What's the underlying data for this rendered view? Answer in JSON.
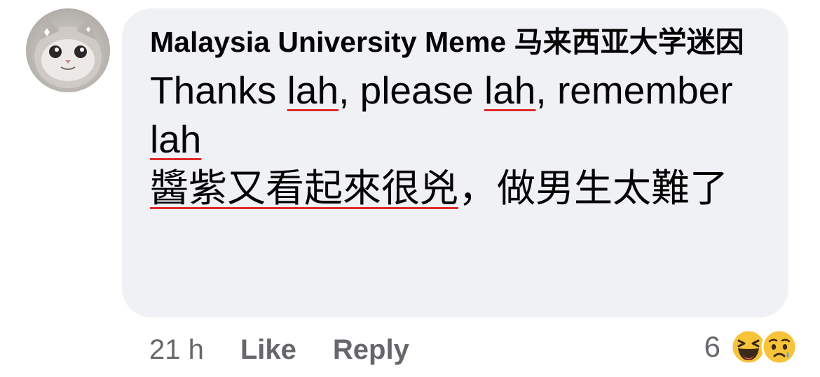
{
  "comment": {
    "author": "Malaysia University Meme 马来西亚大学迷因",
    "message_parts": {
      "p1": "Thanks ",
      "u1": "lah",
      "p2": ", please ",
      "u2": "lah",
      "p3": ", remember ",
      "u3": "lah",
      "u4": "醬紫又看起來很兇",
      "p4": "，做男生太難了"
    },
    "time": "21 h",
    "like_label": "Like",
    "reply_label": "Reply",
    "reaction_count": "6",
    "reactions": [
      "haha-icon",
      "sad-icon"
    ],
    "underline_color": "#e02b2b",
    "bubble_color": "#f0f1f5",
    "meta_color": "#65676b"
  }
}
